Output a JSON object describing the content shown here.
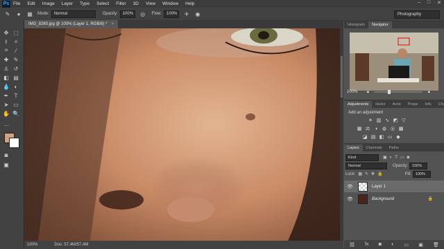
{
  "menubar": {
    "logo": "Ps",
    "items": [
      "File",
      "Edit",
      "Image",
      "Layer",
      "Type",
      "Select",
      "Filter",
      "3D",
      "View",
      "Window",
      "Help"
    ],
    "win_controls": [
      "–",
      "□",
      "✕"
    ]
  },
  "options": {
    "mode_label": "Mode:",
    "mode_value": "Normal",
    "opacity_label": "Opacity:",
    "opacity_value": "100%",
    "flow_label": "Flow:",
    "flow_value": "100%",
    "workspace": "Photography"
  },
  "document": {
    "tab_title": "IMG_8260.jpg @ 100% (Layer 1, RGB/8) *",
    "close": "×"
  },
  "status": {
    "zoom": "100%",
    "doc_info": "Doc: 57,4M/57,4M"
  },
  "navigator_panel": {
    "tabs": [
      "Histogram",
      "Navigator"
    ],
    "zoom": "100%"
  },
  "adjustments_panel": {
    "tabs": [
      "Adjustments",
      "Histor",
      "Actio",
      "Prope",
      "Info",
      "Chan"
    ],
    "add_label": "Add an adjustment"
  },
  "layers_panel": {
    "tabs": [
      "Layers",
      "Channels",
      "Paths"
    ],
    "kind_label": "Kind",
    "blend_mode": "Normal",
    "opacity_label": "Opacity:",
    "opacity_value": "100%",
    "lock_label": "Lock:",
    "fill_label": "Fill:",
    "fill_value": "100%",
    "layers": [
      {
        "name": "Layer 1",
        "active": true
      },
      {
        "name": "Background",
        "active": false
      }
    ]
  },
  "colors": {
    "foreground": "#d2a17e",
    "background": "#ffffff"
  }
}
